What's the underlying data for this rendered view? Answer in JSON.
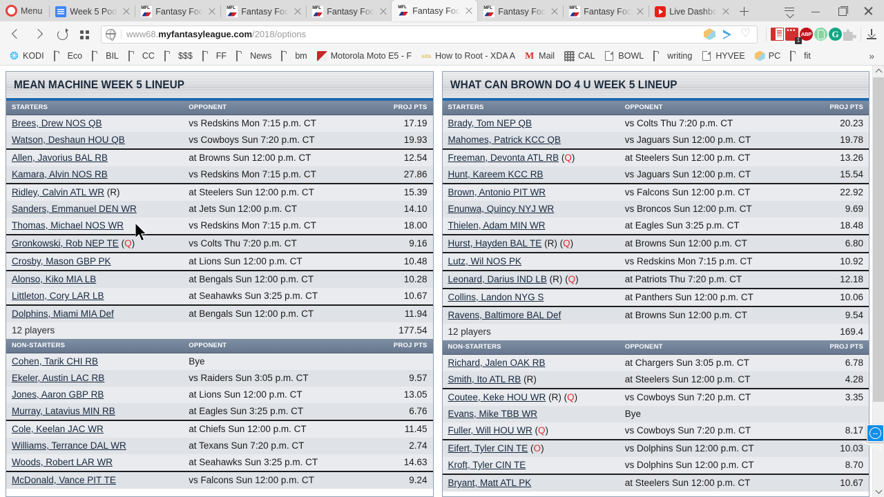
{
  "browser": {
    "menu_label": "Menu",
    "tabs": [
      {
        "title": "Week 5 Podc",
        "icon": "google-docs-icon",
        "active": false
      },
      {
        "title": "Fantasy Foot",
        "icon": "mfl-icon",
        "active": false
      },
      {
        "title": "Fantasy Foot",
        "icon": "mfl-icon",
        "active": false
      },
      {
        "title": "Fantasy Foot",
        "icon": "mfl-icon",
        "active": false
      },
      {
        "title": "Fantasy Foot",
        "icon": "mfl-icon",
        "active": true
      },
      {
        "title": "Fantasy Foot",
        "icon": "mfl-icon",
        "active": false
      },
      {
        "title": "Fantasy Foot",
        "icon": "mfl-icon",
        "active": false
      },
      {
        "title": "Live Dashboa",
        "icon": "youtube-icon",
        "active": false
      }
    ],
    "url": {
      "prefix": "www68.",
      "domain": "myfantasyleague.com",
      "path": "/2018/options"
    },
    "extension_badge_count": "1",
    "bookmarks": [
      {
        "label": "KODI",
        "icon": "kodi-icon"
      },
      {
        "label": "Eco",
        "icon": "folder-icon"
      },
      {
        "label": "BIL",
        "icon": "folder-icon"
      },
      {
        "label": "CC",
        "icon": "folder-icon"
      },
      {
        "label": "$$$",
        "icon": "folder-icon"
      },
      {
        "label": "FF",
        "icon": "folder-icon"
      },
      {
        "label": "News",
        "icon": "folder-icon"
      },
      {
        "label": "bm",
        "icon": "folder-icon"
      },
      {
        "label": "Motorola Moto E5 - F",
        "icon": "motorola-icon"
      },
      {
        "label": "How to Root - XDA A",
        "icon": "xda-icon"
      },
      {
        "label": "Mail",
        "icon": "gmail-icon"
      },
      {
        "label": "CAL",
        "icon": "calendar-icon"
      },
      {
        "label": "BOWL",
        "icon": "page-icon"
      },
      {
        "label": "writing",
        "icon": "folder-icon"
      },
      {
        "label": "HYVEE",
        "icon": "page-icon"
      },
      {
        "label": "PC",
        "icon": "cube-icon"
      },
      {
        "label": "fit",
        "icon": "folder-icon"
      }
    ],
    "overflow_label": "»"
  },
  "columns": {
    "starters": "STARTERS",
    "non_starters": "NON-STARTERS",
    "opponent": "OPPONENT",
    "proj_pts": "PROJ PTS"
  },
  "panels": [
    {
      "title": "MEAN MACHINE WEEK 5 LINEUP",
      "starters": [
        {
          "name": "Brees, Drew NOS QB",
          "tags": [],
          "opponent": "vs Redskins Mon 7:15 p.m. CT",
          "pts": "17.19",
          "group_end": false
        },
        {
          "name": "Watson, Deshaun HOU QB",
          "tags": [],
          "opponent": "vs Cowboys Sun 7:20 p.m. CT",
          "pts": "19.93",
          "group_end": true
        },
        {
          "name": "Allen, Javorius BAL RB",
          "tags": [],
          "opponent": "at Browns Sun 12:00 p.m. CT",
          "pts": "12.54",
          "group_end": false
        },
        {
          "name": "Kamara, Alvin NOS RB",
          "tags": [],
          "opponent": "vs Redskins Mon 7:15 p.m. CT",
          "pts": "27.86",
          "group_end": true
        },
        {
          "name": "Ridley, Calvin ATL WR",
          "tags": [
            "(R)"
          ],
          "opponent": "at Steelers Sun 12:00 p.m. CT",
          "pts": "15.39",
          "group_end": false
        },
        {
          "name": "Sanders, Emmanuel DEN WR",
          "tags": [],
          "opponent": "at Jets Sun 12:00 p.m. CT",
          "pts": "14.10",
          "group_end": false
        },
        {
          "name": "Thomas, Michael NOS WR",
          "tags": [],
          "opponent": "vs Redskins Mon 7:15 p.m. CT",
          "pts": "18.00",
          "group_end": true
        },
        {
          "name": "Gronkowski, Rob NEP TE",
          "tags": [
            "(Q)"
          ],
          "opponent": "vs Colts Thu 7:20 p.m. CT",
          "pts": "9.16",
          "group_end": true
        },
        {
          "name": "Crosby, Mason GBP PK",
          "tags": [],
          "opponent": "at Lions Sun 12:00 p.m. CT",
          "pts": "10.48",
          "group_end": true
        },
        {
          "name": "Alonso, Kiko MIA LB",
          "tags": [],
          "opponent": "at Bengals Sun 12:00 p.m. CT",
          "pts": "10.28",
          "group_end": false
        },
        {
          "name": "Littleton, Cory LAR LB",
          "tags": [],
          "opponent": "at Seahawks Sun 3:25 p.m. CT",
          "pts": "10.67",
          "group_end": true
        },
        {
          "name": "Dolphins, Miami MIA Def",
          "tags": [],
          "opponent": "at Bengals Sun 12:00 p.m. CT",
          "pts": "11.94",
          "group_end": false
        }
      ],
      "starters_total": {
        "label": "12 players",
        "pts": "177.54"
      },
      "non_starters": [
        {
          "name": "Cohen, Tarik CHI RB",
          "tags": [],
          "opponent": "Bye",
          "pts": "",
          "group_end": false
        },
        {
          "name": "Ekeler, Austin LAC RB",
          "tags": [],
          "opponent": "vs Raiders Sun 3:05 p.m. CT",
          "pts": "9.57",
          "group_end": false
        },
        {
          "name": "Jones, Aaron GBP RB",
          "tags": [],
          "opponent": "at Lions Sun 12:00 p.m. CT",
          "pts": "13.05",
          "group_end": false
        },
        {
          "name": "Murray, Latavius MIN RB",
          "tags": [],
          "opponent": "at Eagles Sun 3:25 p.m. CT",
          "pts": "6.76",
          "group_end": true
        },
        {
          "name": "Cole, Keelan JAC WR",
          "tags": [],
          "opponent": "at Chiefs Sun 12:00 p.m. CT",
          "pts": "11.45",
          "group_end": false
        },
        {
          "name": "Williams, Terrance DAL WR",
          "tags": [],
          "opponent": "at Texans Sun 7:20 p.m. CT",
          "pts": "2.74",
          "group_end": false
        },
        {
          "name": "Woods, Robert LAR WR",
          "tags": [],
          "opponent": "at Seahawks Sun 3:25 p.m. CT",
          "pts": "14.63",
          "group_end": true
        },
        {
          "name": "McDonald, Vance PIT TE",
          "tags": [],
          "opponent": "vs Falcons Sun 12:00 p.m. CT",
          "pts": "9.24",
          "group_end": false
        }
      ]
    },
    {
      "title": "WHAT CAN BROWN DO 4 U WEEK 5 LINEUP",
      "starters": [
        {
          "name": "Brady, Tom NEP QB",
          "tags": [],
          "opponent": "vs Colts Thu 7:20 p.m. CT",
          "pts": "20.23",
          "group_end": false
        },
        {
          "name": "Mahomes, Patrick KCC QB",
          "tags": [],
          "opponent": "vs Jaguars Sun 12:00 p.m. CT",
          "pts": "19.78",
          "group_end": true
        },
        {
          "name": "Freeman, Devonta ATL RB",
          "tags": [
            "(Q)"
          ],
          "opponent": "at Steelers Sun 12:00 p.m. CT",
          "pts": "13.26",
          "group_end": false
        },
        {
          "name": "Hunt, Kareem KCC RB",
          "tags": [],
          "opponent": "vs Jaguars Sun 12:00 p.m. CT",
          "pts": "15.54",
          "group_end": true
        },
        {
          "name": "Brown, Antonio PIT WR",
          "tags": [],
          "opponent": "vs Falcons Sun 12:00 p.m. CT",
          "pts": "22.92",
          "group_end": false
        },
        {
          "name": "Enunwa, Quincy NYJ WR",
          "tags": [],
          "opponent": "vs Broncos Sun 12:00 p.m. CT",
          "pts": "9.69",
          "group_end": false
        },
        {
          "name": "Thielen, Adam MIN WR",
          "tags": [],
          "opponent": "at Eagles Sun 3:25 p.m. CT",
          "pts": "18.48",
          "group_end": true
        },
        {
          "name": "Hurst, Hayden BAL TE",
          "tags": [
            "(R)",
            "(Q)"
          ],
          "opponent": "at Browns Sun 12:00 p.m. CT",
          "pts": "6.80",
          "group_end": true
        },
        {
          "name": "Lutz, Wil NOS PK",
          "tags": [],
          "opponent": "vs Redskins Mon 7:15 p.m. CT",
          "pts": "10.92",
          "group_end": true
        },
        {
          "name": "Leonard, Darius IND LB",
          "tags": [
            "(R)",
            "(Q)"
          ],
          "opponent": "at Patriots Thu 7:20 p.m. CT",
          "pts": "12.18",
          "group_end": true
        },
        {
          "name": "Collins, Landon NYG S",
          "tags": [],
          "opponent": "at Panthers Sun 12:00 p.m. CT",
          "pts": "10.06",
          "group_end": true
        },
        {
          "name": "Ravens, Baltimore BAL Def",
          "tags": [],
          "opponent": "at Browns Sun 12:00 p.m. CT",
          "pts": "9.54",
          "group_end": false
        }
      ],
      "starters_total": {
        "label": "12 players",
        "pts": "169.4"
      },
      "non_starters": [
        {
          "name": "Richard, Jalen OAK RB",
          "tags": [],
          "opponent": "at Chargers Sun 3:05 p.m. CT",
          "pts": "6.78",
          "group_end": false
        },
        {
          "name": "Smith, Ito ATL RB",
          "tags": [
            "(R)"
          ],
          "opponent": "at Steelers Sun 12:00 p.m. CT",
          "pts": "4.28",
          "group_end": true
        },
        {
          "name": "Coutee, Keke HOU WR",
          "tags": [
            "(R)",
            "(Q)"
          ],
          "opponent": "vs Cowboys Sun 7:20 p.m. CT",
          "pts": "3.35",
          "group_end": false
        },
        {
          "name": "Evans, Mike TBB WR",
          "tags": [],
          "opponent": "Bye",
          "pts": "",
          "group_end": false
        },
        {
          "name": "Fuller, Will HOU WR",
          "tags": [
            "(Q)"
          ],
          "opponent": "vs Cowboys Sun 7:20 p.m. CT",
          "pts": "8.17",
          "group_end": true
        },
        {
          "name": "Eifert, Tyler CIN TE",
          "tags": [
            "(O)"
          ],
          "opponent": "vs Dolphins Sun 12:00 p.m. CT",
          "pts": "10.03",
          "group_end": false
        },
        {
          "name": "Kroft, Tyler CIN TE",
          "tags": [],
          "opponent": "vs Dolphins Sun 12:00 p.m. CT",
          "pts": "8.70",
          "group_end": true
        },
        {
          "name": "Bryant, Matt ATL PK",
          "tags": [],
          "opponent": "at Steelers Sun 12:00 p.m. CT",
          "pts": "10.67",
          "group_end": false
        }
      ]
    }
  ],
  "colors": {
    "accent_blue": "#1f6bb0",
    "header_row": "#67778e",
    "row_odd": "#e9ebef",
    "row_even": "#dfe2e7",
    "status_red": "#e02a2a",
    "link": "#16283e"
  }
}
